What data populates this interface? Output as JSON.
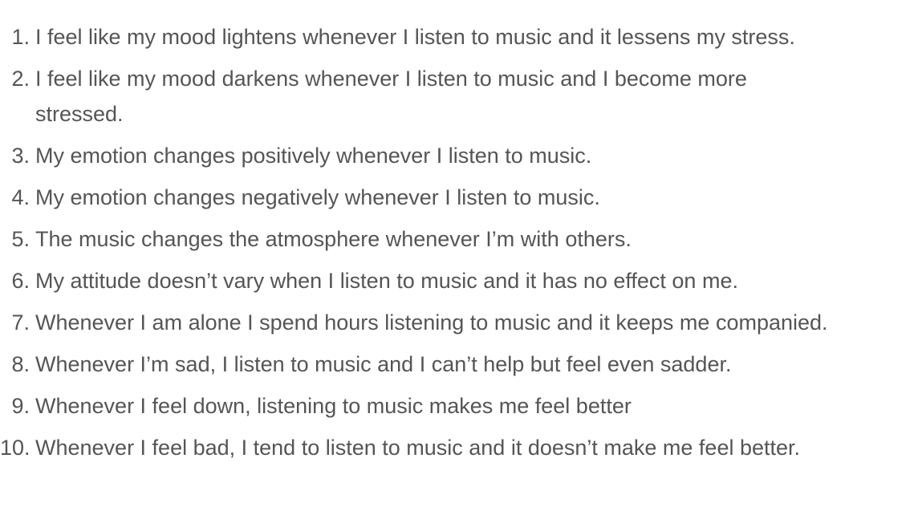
{
  "items": [
    {
      "number": "1.",
      "text": "I feel like my mood lightens whenever I listen to music and it lessens my stress."
    },
    {
      "number": "2.",
      "text": "I feel like my mood darkens whenever I listen to music and I become more stressed."
    },
    {
      "number": "3.",
      "text": "My emotion changes positively whenever I listen to music."
    },
    {
      "number": "4.",
      "text": "My emotion changes negatively whenever I listen to music."
    },
    {
      "number": "5.",
      "text": "The music changes the atmosphere whenever I’m with others."
    },
    {
      "number": "6.",
      "text": "My attitude doesn’t vary when I listen to music and it has no effect on me."
    },
    {
      "number": "7.",
      "text": "Whenever I am alone I spend hours listening to music and it keeps me companied."
    },
    {
      "number": "8.",
      "text": "Whenever I’m sad, I listen to music and I can’t help but feel even sadder."
    },
    {
      "number": "9.",
      "text": "Whenever I feel down, listening to music makes me feel better"
    },
    {
      "number": "10.",
      "text": "Whenever I feel bad, I tend to listen to music and it doesn’t make me feel better."
    }
  ]
}
